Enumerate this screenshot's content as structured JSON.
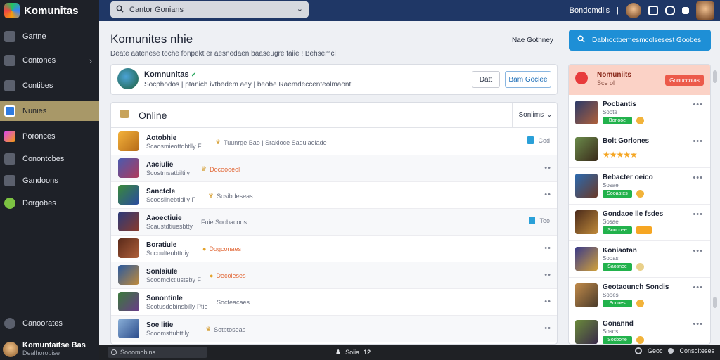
{
  "app": {
    "name": "Komunitas"
  },
  "sidebar": {
    "items": [
      {
        "label": "Gartne"
      },
      {
        "label": "Contones"
      },
      {
        "label": "Contibes"
      },
      {
        "label": "Nunies"
      },
      {
        "label": "Poronces"
      },
      {
        "label": "Conontobes"
      },
      {
        "label": "Gandoons"
      },
      {
        "label": "Dorgobes"
      }
    ],
    "bottom_label": "Canoorates",
    "user": {
      "name": "Komuntaitse Bas",
      "sub": "Dealhorobise"
    }
  },
  "topbar": {
    "search_text": "Cantor Gonians",
    "right_text": "Bondomdiis"
  },
  "page": {
    "title": "Komunites nhie",
    "description": "Deate aatenese toche fonpekt er aesnedaen baaseugre faiie  !  Behsemcl",
    "link_right": "Nae Gothney",
    "primary_button": "Dabhoctbemesmcolsesest Goobes"
  },
  "community_card": {
    "name": "Komnunitas",
    "subtitle": "Socphodos | ptanich ivtbedem aey | beobe   Raemdeccenteolmaont",
    "button_1": "Datt",
    "button_2": "Bam Goclee"
  },
  "online": {
    "title": "Online",
    "sort_label": "Sonlims",
    "rows": [
      {
        "name": "Aotobhie",
        "meta": "Scaosmieottdbtlly  F",
        "tag": "Tuunrge Bao  |  Srakioce Sadulaeiade",
        "tag_color": "#6a7080",
        "action": "Cod"
      },
      {
        "name": "Aaciulie",
        "meta": "Scostmsatbiltily",
        "tag": "Docoooeol",
        "tag_color": "#e26a3a",
        "action": ""
      },
      {
        "name": "Sanctcle",
        "meta": "Scoosllnebtidily  F",
        "tag": "Sosibdeseas",
        "tag_color": "#6a7080",
        "action": ""
      },
      {
        "name": "Aaoectiuie",
        "meta": "Scaustdtiuesbtty",
        "tag": "Fuie  Soobacoos",
        "tag_color": "#6a7080",
        "action": "Teo"
      },
      {
        "name": "Boratiule",
        "meta": "Sccoulteubttdiy",
        "tag": "Dogconaes",
        "tag_color": "#e26a3a",
        "action": ""
      },
      {
        "name": "Sonlaiule",
        "meta": "Scoomclctiusteby  F",
        "tag": "Decoleses",
        "tag_color": "#e26a3a",
        "action": ""
      },
      {
        "name": "Sonontinle",
        "meta": "Scotusdebinsbilly  Ptie",
        "tag": "Socteacaes",
        "tag_color": "#6a7080",
        "action": ""
      },
      {
        "name": "Soe litie",
        "meta": "Scoomsttubttlly",
        "tag": "Sotbtoseas",
        "tag_color": "#6a7080",
        "action": ""
      }
    ]
  },
  "right_panel": {
    "header_title": "Nomuniits",
    "header_sub": "Sce ol",
    "header_button": "Gonuccotas",
    "items": [
      {
        "name": "Pocbantis",
        "meta": "Soote",
        "chip": "Bonooe"
      },
      {
        "name": "Bolt Gorlones",
        "meta": "",
        "chip": ""
      },
      {
        "name": "Bebacter oeico",
        "meta": "Sosae",
        "chip": "Sooaates"
      },
      {
        "name": "Gondaoe lle fsdes",
        "meta": "Sosae",
        "chip": "Soocoee"
      },
      {
        "name": "Koniaotan",
        "meta": "Sooas",
        "chip": "Saosnoe"
      },
      {
        "name": "Geotaounch Sondis",
        "meta": "Sooes",
        "chip": "Socoes"
      },
      {
        "name": "Gonannd",
        "meta": "Sosos",
        "chip": "Sosbone"
      }
    ]
  },
  "bottombar": {
    "input_text": "Sooomobins",
    "center_text": "Soiia",
    "center_num": "12",
    "right_1": "Geoc",
    "right_2": "Consoiteses"
  },
  "colors": {
    "sidebar_bg": "#1e2128",
    "topbar_bg": "#1f3766",
    "accent_blue": "#1e8fd6",
    "active_nav": "#a89868",
    "online_green": "#22b24c",
    "header_red": "#ec5a4a"
  }
}
